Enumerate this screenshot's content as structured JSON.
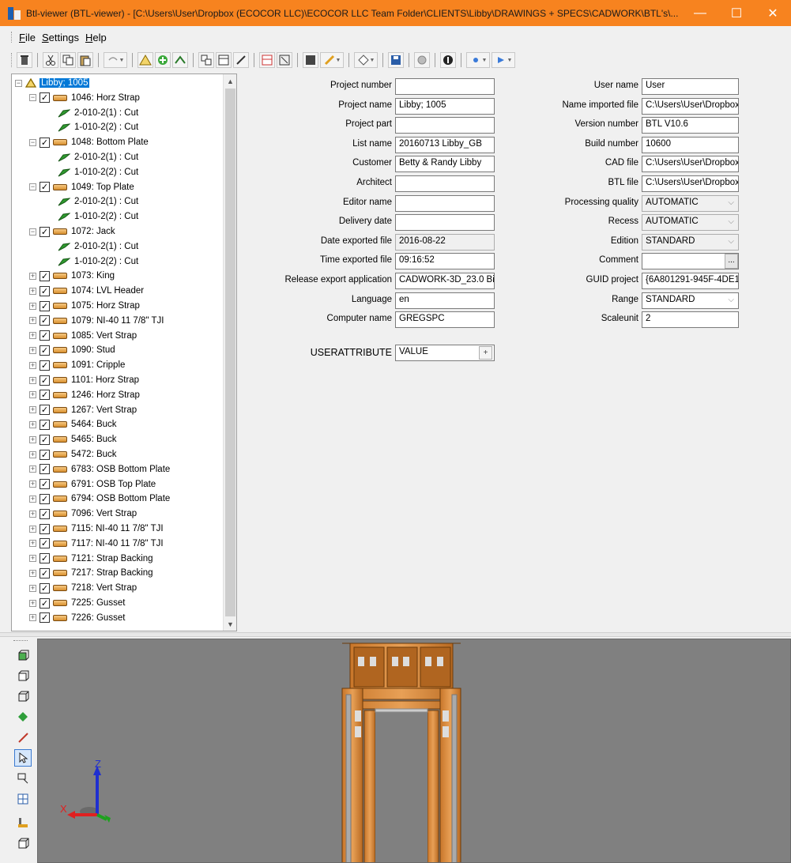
{
  "window": {
    "title": "Btl-viewer (BTL-viewer) - [C:\\Users\\User\\Dropbox (ECOCOR LLC)\\ECOCOR LLC Team Folder\\CLIENTS\\Libby\\DRAWINGS + SPECS\\CADWORK\\BTL's\\...",
    "minimize": "—",
    "maximize": "☐",
    "close": "✕"
  },
  "menu": {
    "file": {
      "first": "F",
      "rest": "ile"
    },
    "settings": {
      "first": "S",
      "rest": "ettings"
    },
    "help": {
      "first": "H",
      "rest": "elp"
    }
  },
  "tree": {
    "root": "Libby; 1005",
    "items": [
      {
        "label": "1046: Horz Strap",
        "expanded": true,
        "children": [
          "2-010-2(1) : Cut",
          "1-010-2(2) : Cut"
        ]
      },
      {
        "label": "1048: Bottom Plate",
        "expanded": true,
        "children": [
          "2-010-2(1) : Cut",
          "1-010-2(2) : Cut"
        ]
      },
      {
        "label": "1049: Top Plate",
        "expanded": true,
        "children": [
          "2-010-2(1) : Cut",
          "1-010-2(2) : Cut"
        ]
      },
      {
        "label": "1072: Jack",
        "expanded": true,
        "children": [
          "2-010-2(1) : Cut",
          "1-010-2(2) : Cut"
        ]
      },
      {
        "label": "1073: King",
        "expanded": false
      },
      {
        "label": "1074: LVL Header",
        "expanded": false
      },
      {
        "label": "1075: Horz Strap",
        "expanded": false
      },
      {
        "label": "1079: NI-40 11 7/8\" TJI",
        "expanded": false
      },
      {
        "label": "1085: Vert Strap",
        "expanded": false
      },
      {
        "label": "1090: Stud",
        "expanded": false
      },
      {
        "label": "1091: Cripple",
        "expanded": false
      },
      {
        "label": "1101: Horz Strap",
        "expanded": false
      },
      {
        "label": "1246: Horz Strap",
        "expanded": false
      },
      {
        "label": "1267: Vert Strap",
        "expanded": false
      },
      {
        "label": "5464: Buck",
        "expanded": false
      },
      {
        "label": "5465: Buck",
        "expanded": false
      },
      {
        "label": "5472: Buck",
        "expanded": false
      },
      {
        "label": "6783: OSB Bottom Plate",
        "expanded": false
      },
      {
        "label": "6791: OSB Top Plate",
        "expanded": false
      },
      {
        "label": "6794: OSB Bottom Plate",
        "expanded": false
      },
      {
        "label": "7096: Vert Strap",
        "expanded": false
      },
      {
        "label": "7115: NI-40 11 7/8\" TJI",
        "expanded": false
      },
      {
        "label": "7117: NI-40 11 7/8\" TJI",
        "expanded": false
      },
      {
        "label": "7121: Strap Backing",
        "expanded": false
      },
      {
        "label": "7217: Strap Backing",
        "expanded": false
      },
      {
        "label": "7218: Vert Strap",
        "expanded": false
      },
      {
        "label": "7225: Gusset",
        "expanded": false
      },
      {
        "label": "7226: Gusset",
        "expanded": false
      }
    ]
  },
  "props_left": [
    {
      "key": "project_number",
      "label": "Project number",
      "value": "",
      "disabled": false
    },
    {
      "key": "project_name",
      "label": "Project name",
      "value": "Libby; 1005",
      "disabled": false
    },
    {
      "key": "project_part",
      "label": "Project part",
      "value": "",
      "disabled": false
    },
    {
      "key": "list_name",
      "label": "List name",
      "value": "20160713 Libby_GB",
      "disabled": false
    },
    {
      "key": "customer",
      "label": "Customer",
      "value": "Betty & Randy Libby",
      "disabled": false
    },
    {
      "key": "architect",
      "label": "Architect",
      "value": "",
      "disabled": false
    },
    {
      "key": "editor_name",
      "label": "Editor name",
      "value": "",
      "disabled": false
    },
    {
      "key": "delivery_date",
      "label": "Delivery date",
      "value": "",
      "disabled": false
    },
    {
      "key": "date_exported",
      "label": "Date exported file",
      "value": "2016-08-22",
      "disabled": true
    },
    {
      "key": "time_exported",
      "label": "Time exported file",
      "value": "09:16:52",
      "disabled": false
    },
    {
      "key": "release_export",
      "label": "Release export application",
      "value": "CADWORK-3D_23.0 Bi",
      "disabled": false
    },
    {
      "key": "language",
      "label": "Language",
      "value": "en",
      "disabled": false
    },
    {
      "key": "computer_name",
      "label": "Computer name",
      "value": "GREGSPC",
      "disabled": false
    }
  ],
  "userattribute": {
    "label": "USERATTRIBUTE",
    "value": "VALUE",
    "plus": "+"
  },
  "props_right": [
    {
      "key": "user_name",
      "label": "User name",
      "value": "User",
      "kind": "text"
    },
    {
      "key": "name_imported",
      "label": "Name imported file",
      "value": "C:\\Users\\User\\Dropbox",
      "kind": "text"
    },
    {
      "key": "version_number",
      "label": "Version number",
      "value": "BTL V10.6",
      "kind": "text"
    },
    {
      "key": "build_number",
      "label": "Build number",
      "value": "10600",
      "kind": "text"
    },
    {
      "key": "cad_file",
      "label": "CAD file",
      "value": "C:\\Users\\User\\Dropbox",
      "kind": "text"
    },
    {
      "key": "btl_file",
      "label": "BTL file",
      "value": "C:\\Users\\User\\Dropbox",
      "kind": "text"
    },
    {
      "key": "processing_quality",
      "label": "Processing quality",
      "value": "AUTOMATIC",
      "kind": "combo-disabled"
    },
    {
      "key": "recess",
      "label": "Recess",
      "value": "AUTOMATIC",
      "kind": "combo-disabled"
    },
    {
      "key": "edition",
      "label": "Edition",
      "value": "STANDARD",
      "kind": "combo-disabled"
    },
    {
      "key": "comment",
      "label": "Comment",
      "value": "",
      "kind": "ellipsis"
    },
    {
      "key": "guid_project",
      "label": "GUID project",
      "value": "{6A801291-945F-4DE1-",
      "kind": "text"
    },
    {
      "key": "range",
      "label": "Range",
      "value": "STANDARD",
      "kind": "combo-enabled"
    },
    {
      "key": "scaleunit",
      "label": "Scaleunit",
      "value": "2",
      "kind": "text"
    }
  ],
  "viewport": {
    "axis_x": "X",
    "axis_z": "Z",
    "colors": {
      "background": "#808080",
      "wood": "#d98a3a",
      "axis_x": "#e02020",
      "axis_y": "#1fa11f",
      "axis_z": "#1f2fd0"
    }
  },
  "icons": {
    "toolbar": [
      "delete-icon",
      "cut-icon",
      "copy-icon",
      "paste-icon",
      "undo-icon",
      "triangle-icon",
      "add-icon",
      "cut-tool-icon",
      "layout-icon",
      "layout2-icon",
      "edit-icon",
      "table-icon",
      "clear-icon",
      "grid-icon",
      "pencil-icon",
      "eraser-icon",
      "save-icon",
      "settings-icon",
      "info-icon",
      "nav-prev-icon",
      "nav-next-icon"
    ],
    "vtoolbar": [
      "view-front-icon",
      "view-iso-icon",
      "view-iso2-icon",
      "green-diamond-icon",
      "measure-icon",
      "pointer-icon",
      "zoom-window-icon",
      "fit-icon",
      "level-icon",
      "box-icon"
    ]
  }
}
